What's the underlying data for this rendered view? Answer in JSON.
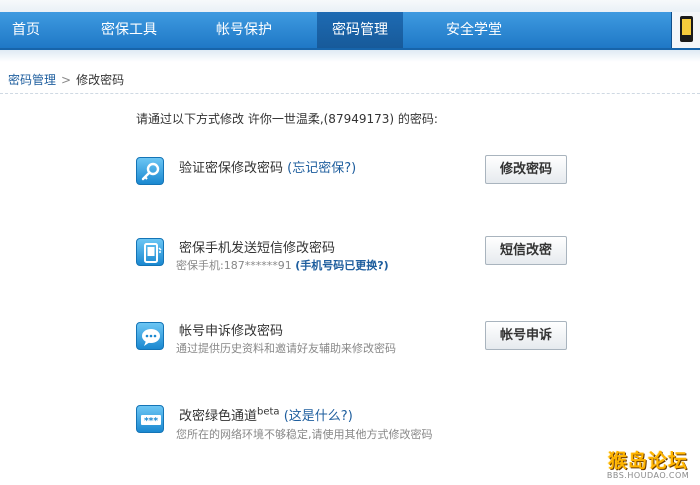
{
  "nav": {
    "items": [
      {
        "label": "首页"
      },
      {
        "label": "密保工具"
      },
      {
        "label": "帐号保护"
      },
      {
        "label": "密码管理",
        "active": true
      },
      {
        "label": "安全学堂"
      }
    ]
  },
  "breadcrumb": {
    "parent": "密码管理",
    "separator": ">",
    "current": "修改密码"
  },
  "intro": "请通过以下方式修改 许你一世温柔,(87949173) 的密码:",
  "options": [
    {
      "icon": "key-icon",
      "title": "验证密保修改密码",
      "link": "(忘记密保?)",
      "button": "修改密码"
    },
    {
      "icon": "phone-sms-icon",
      "title": "密保手机发送短信修改密码",
      "desc_prefix": "密保手机:187******91",
      "desc_link": "(手机号码已更换?)",
      "button": "短信改密"
    },
    {
      "icon": "chat-bubble-icon",
      "title": "帐号申诉修改密码",
      "desc": "通过提供历史资料和邀请好友辅助来修改密码",
      "button": "帐号申诉"
    },
    {
      "icon": "password-field-icon",
      "title": "改密绿色通道",
      "sup": "beta",
      "link": "(这是什么?)",
      "desc": "您所在的网络环境不够稳定,请使用其他方式修改密码"
    }
  ],
  "watermark": {
    "title": "猴岛论坛",
    "url": "BBS.HOUDAO.COM"
  },
  "colors": {
    "nav_bg": "#2b87d4",
    "nav_active": "#1a62a6",
    "link": "#1e5e9e",
    "muted": "#888888"
  }
}
